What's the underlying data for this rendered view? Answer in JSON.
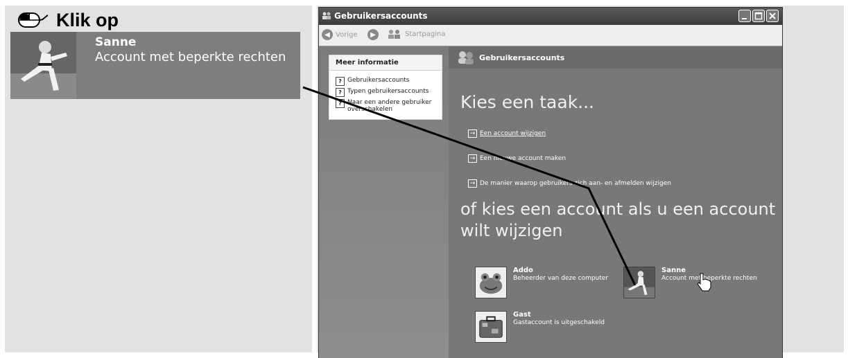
{
  "instruction": {
    "text": "Klik op",
    "icon": "mouse-icon"
  },
  "callout": {
    "name": "Sanne",
    "role": "Account met beperkte rechten"
  },
  "window": {
    "title": "Gebruikersaccounts",
    "toolbar": {
      "back": "Vorige",
      "home": "Startpagina"
    }
  },
  "sidebar": {
    "heading": "Meer informatie",
    "links": [
      "Gebruikersaccounts",
      "Typen gebruikersaccounts",
      "Naar een andere gebruiker overschakelen"
    ]
  },
  "main": {
    "header": "Gebruikersaccounts",
    "task_heading": "Kies een taak...",
    "tasks": [
      "Een account wijzigen",
      "Een nieuwe account maken",
      "De manier waarop gebruikers zich aan- en afmelden wijzigen"
    ],
    "account_heading": "of kies een account als u een account wilt wijzigen",
    "accounts": [
      {
        "name": "Addo",
        "desc": "Beheerder van deze computer"
      },
      {
        "name": "Sanne",
        "desc": "Account met beperkte rechten"
      },
      {
        "name": "Gast",
        "desc": "Gastaccount is uitgeschakeld"
      }
    ]
  },
  "colors": {
    "panel": "#e2e2e2",
    "window": "#7a7a7a",
    "titlebar": "#3b3b3b"
  }
}
